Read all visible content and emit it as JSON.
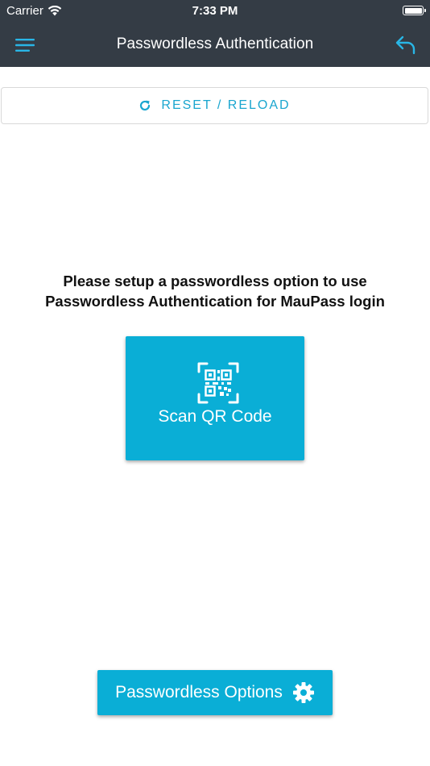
{
  "status_bar": {
    "carrier": "Carrier",
    "time": "7:33 PM",
    "icons": [
      "wifi-icon",
      "battery-icon"
    ]
  },
  "nav": {
    "title": "Passwordless Authentication",
    "menu_icon": "hamburger-menu-icon",
    "back_icon": "undo-arrow-icon"
  },
  "reset": {
    "label": "RESET / RELOAD",
    "icon": "refresh-icon"
  },
  "message": {
    "line1": "Please setup a passwordless option to use",
    "line2": "Passwordless Authentication for MauPass login"
  },
  "scan": {
    "label": "Scan QR Code",
    "icon": "qr-scan-icon"
  },
  "options": {
    "label": "Passwordless Options",
    "icon": "gear-icon"
  },
  "colors": {
    "header": "#343c45",
    "accent": "#0aaed6",
    "reset_text": "#1aa6cf",
    "menu_icon": "#29b6e6"
  }
}
